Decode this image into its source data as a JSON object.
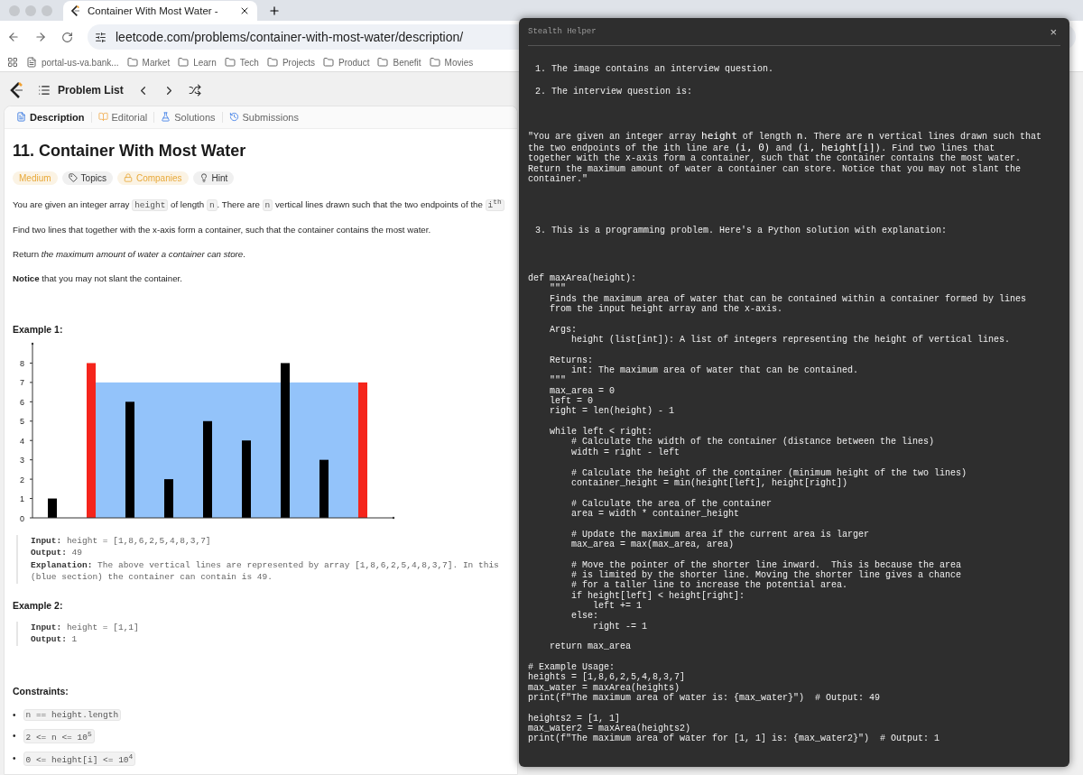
{
  "browser": {
    "tab_title": "Container With Most Water -",
    "url": "leetcode.com/problems/container-with-most-water/description/",
    "bookmarks": [
      {
        "label": "portal-us-va.bank...",
        "kind": "page"
      },
      {
        "label": "Market",
        "kind": "folder"
      },
      {
        "label": "Learn",
        "kind": "folder"
      },
      {
        "label": "Tech",
        "kind": "folder"
      },
      {
        "label": "Projects",
        "kind": "folder"
      },
      {
        "label": "Product",
        "kind": "folder"
      },
      {
        "label": "Benefit",
        "kind": "folder"
      },
      {
        "label": "Movies",
        "kind": "folder"
      }
    ]
  },
  "app_header": {
    "label": "Problem List"
  },
  "tabs": [
    {
      "label": "Description",
      "kind": "description",
      "selected": true
    },
    {
      "label": "Editorial",
      "kind": "editorial",
      "selected": false
    },
    {
      "label": "Solutions",
      "kind": "solutions",
      "selected": false
    },
    {
      "label": "Submissions",
      "kind": "submissions",
      "selected": false
    }
  ],
  "problem": {
    "title": "11. Container With Most Water",
    "tags": [
      {
        "label": "Medium",
        "kind": "difficulty"
      },
      {
        "label": "Topics",
        "kind": "topics"
      },
      {
        "label": "Companies",
        "kind": "companies"
      },
      {
        "label": "Hint",
        "kind": "hint"
      }
    ],
    "description": [
      [
        {
          "kind": "text",
          "text": "You are given an integer array "
        },
        {
          "kind": "code",
          "text": "height"
        },
        {
          "kind": "text",
          "text": " of length "
        },
        {
          "kind": "code",
          "text": "n"
        },
        {
          "kind": "text",
          "text": ". There are "
        },
        {
          "kind": "code",
          "text": "n"
        },
        {
          "kind": "text",
          "text": " vertical lines drawn such that the two endpoints of the "
        },
        {
          "kind": "code",
          "text": "i$^{th}$"
        }
      ],
      [
        {
          "kind": "text",
          "text": "Find two lines that together with the x-axis form a container, such that the container contains the most water."
        }
      ],
      [
        {
          "kind": "text",
          "text": "Return *the maximum amount of water a container can store*."
        }
      ],
      [
        {
          "kind": "text",
          "text": "**Notice** that you may not slant the container."
        }
      ]
    ],
    "examples": [
      {
        "title": "Example 1:",
        "kind": "chart",
        "chart_data": {
          "type": "bar",
          "ylim": [
            0,
            9
          ],
          "yticks": [
            0,
            1,
            2,
            3,
            4,
            5,
            6,
            7,
            8
          ],
          "series": [
            {
              "color": "#000000",
              "values": [
                1,
                null,
                6,
                2,
                5,
                4,
                8,
                3,
                null
              ]
            },
            {
              "color": "#f5251c",
              "values": [
                null,
                8,
                null,
                null,
                null,
                null,
                null,
                null,
                7
              ]
            }
          ]
        },
        "lines": [
          "**Input:** height = [1,8,6,2,5,4,8,3,7]",
          "**Output:** 49",
          "**Explanation:** The above vertical lines are represented by array [1,8,6,2,5,4,8,3,7]. In this",
          "(blue section) the container can contain is 49."
        ]
      },
      {
        "title": "Example 2:",
        "kind": "plain",
        "lines": [
          "**Input:** height = [1,1]",
          "**Output:** 1"
        ]
      }
    ],
    "constraints_title": "Constraints:",
    "constraints": [
      {
        "marker": "•",
        "text": "n == height.length"
      },
      {
        "marker": "•",
        "text": "2 <= n <= 10$^{5}$"
      },
      {
        "marker": "•",
        "text": "0 <= height[i] <= 10$^{4}$"
      }
    ]
  },
  "helper": {
    "title": "Stealth Helper",
    "close": "×",
    "items": [
      {
        "number": "1.",
        "text": "The image contains an interview question."
      },
      {
        "number": "2.",
        "text": "The interview question is:"
      }
    ],
    "quote": "\"You are given an integer array **height** of length **n**. There are **n** vertical lines drawn such that the two endpoints of the **i**th line are **(i, 0)** and **(i, height[i])**. Find two lines that together with the x-axis form a container, such that the container contains the most water. Return the maximum amount of water a container can store. Notice that you may not slant the container.\"",
    "item3": {
      "number": "3.",
      "text": "This is a programming problem. Here's a Python solution with explanation:"
    },
    "code": "def maxArea(height):\n    \"\"\"\n    Finds the maximum area of water that can be contained within a container formed by lines\n    from the input height array and the x-axis.\n\n    Args:\n        height (list[int]): A list of integers representing the height of vertical lines.\n\n    Returns:\n        int: The maximum area of water that can be contained.\n    \"\"\"\n    max_area = 0\n    left = 0\n    right = len(height) - 1\n\n    while left < right:\n        # Calculate the width of the container (distance between the lines)\n        width = right - left\n\n        # Calculate the height of the container (minimum height of the two lines)\n        container_height = min(height[left], height[right])\n\n        # Calculate the area of the container\n        area = width * container_height\n\n        # Update the maximum area if the current area is larger\n        max_area = max(max_area, area)\n\n        # Move the pointer of the shorter line inward.  This is because the area\n        # is limited by the shorter line. Moving the shorter line gives a chance\n        # for a taller line to increase the potential area.\n        if height[left] < height[right]:\n            left += 1\n        else:\n            right -= 1\n\n    return max_area\n\n# Example Usage:\nheights = [1,8,6,2,5,4,8,3,7]\nmax_water = maxArea(heights)\nprint(f\"The maximum area of water is: {max_water}\")  # Output: 49\n\nheights2 = [1, 1]\nmax_water2 = maxArea(heights2)\nprint(f\"The maximum area of water for [1, 1] is: {max_water2}\")  # Output: 1"
  }
}
